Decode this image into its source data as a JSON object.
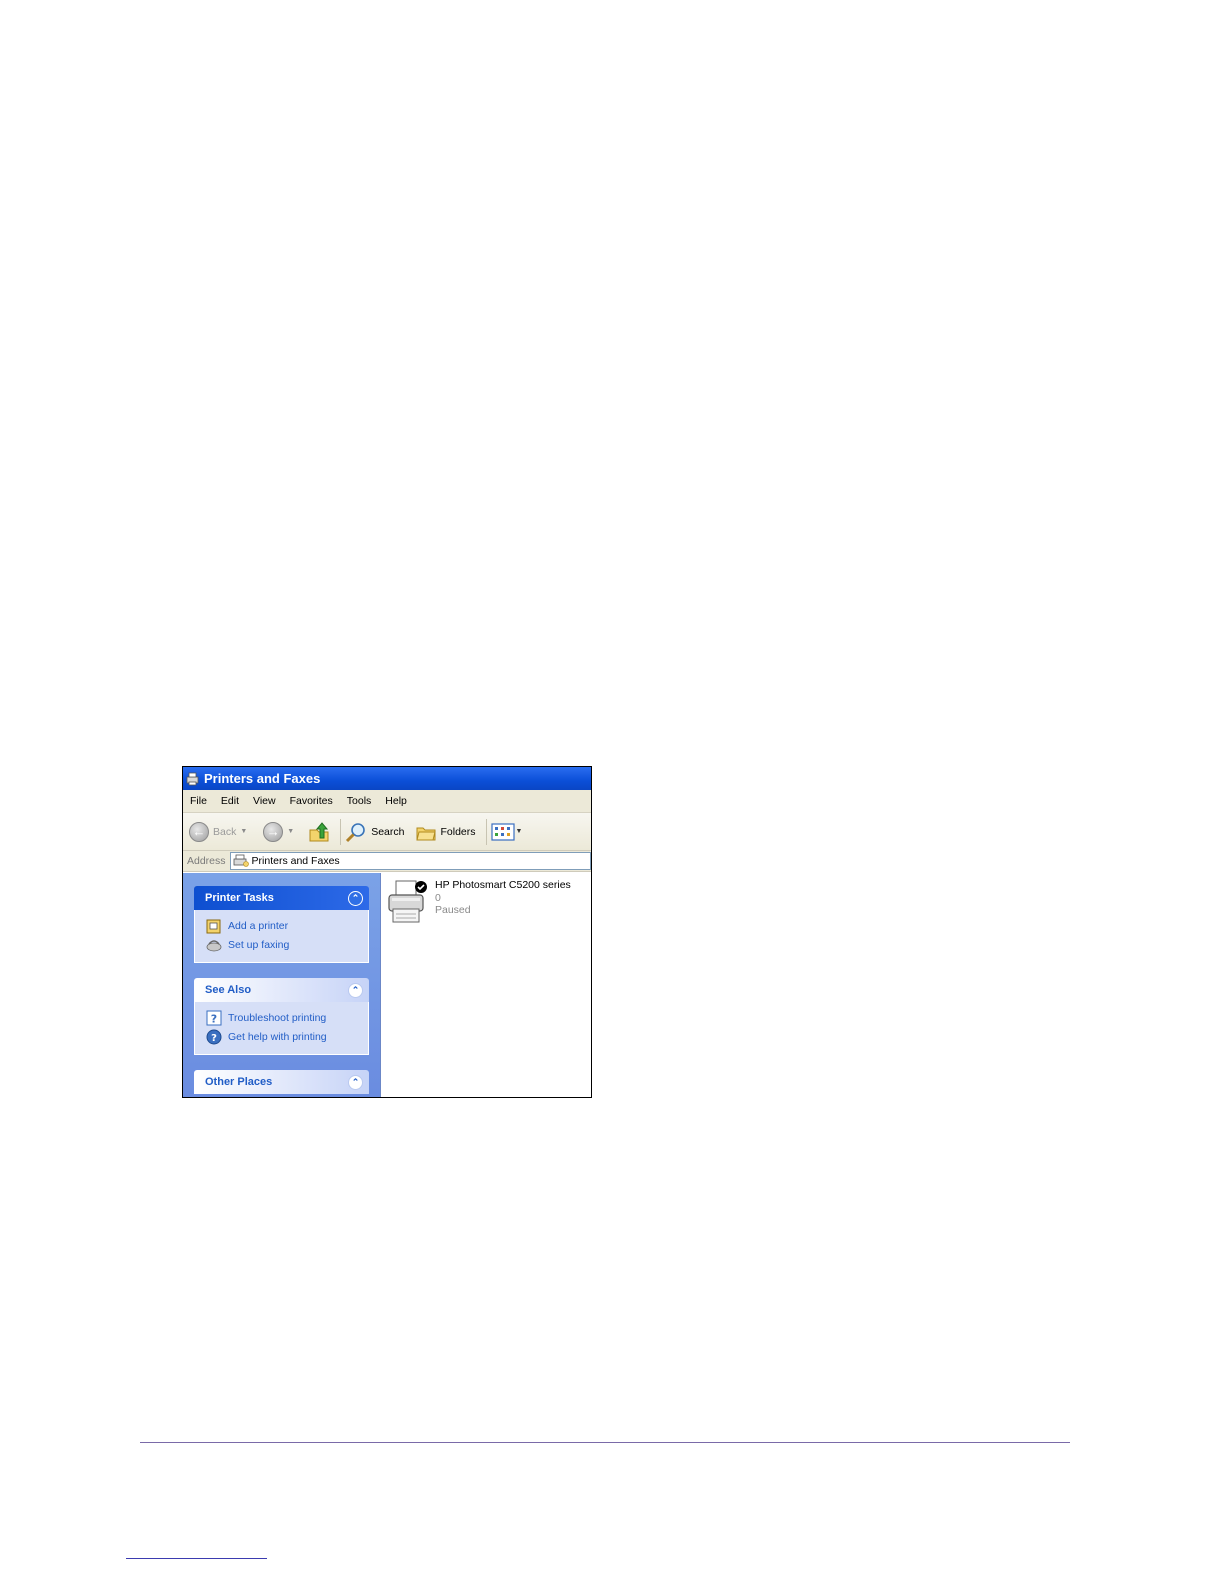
{
  "window": {
    "title": "Printers and Faxes"
  },
  "menu": [
    "File",
    "Edit",
    "View",
    "Favorites",
    "Tools",
    "Help"
  ],
  "toolbar": {
    "back_label": "Back",
    "search_label": "Search",
    "folders_label": "Folders"
  },
  "address": {
    "label": "Address",
    "value": "Printers and Faxes"
  },
  "taskpane": {
    "printer_tasks": {
      "title": "Printer Tasks",
      "items": [
        "Add a printer",
        "Set up faxing"
      ]
    },
    "see_also": {
      "title": "See Also",
      "items": [
        "Troubleshoot printing",
        "Get help with printing"
      ]
    },
    "other_places": {
      "title": "Other Places"
    }
  },
  "printers": [
    {
      "name": "HP Photosmart C5200 series",
      "documents": "0",
      "status": "Paused",
      "default": true
    }
  ],
  "colors": {
    "titlebar": "#0b4fd8",
    "taskpane": "#7ba2e7",
    "link": "#215dc6"
  }
}
